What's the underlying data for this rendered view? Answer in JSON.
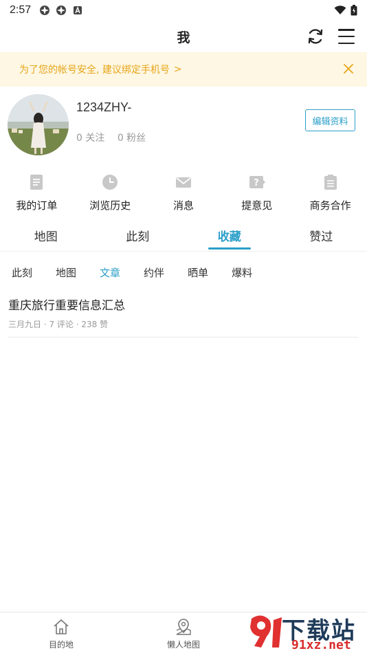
{
  "status_bar": {
    "time": "2:57"
  },
  "header": {
    "title": "我"
  },
  "notice": {
    "text": "为了您的帐号安全, 建议绑定手机号",
    "chevron": ">"
  },
  "profile": {
    "username": "1234ZHY-",
    "following": "0 关注",
    "fans": "0 粉丝",
    "edit_label": "编辑资料"
  },
  "quick_actions": [
    {
      "label": "我的订单",
      "icon": "order-icon"
    },
    {
      "label": "浏览历史",
      "icon": "clock-icon"
    },
    {
      "label": "消息",
      "icon": "mail-icon"
    },
    {
      "label": "提意见",
      "icon": "feedback-icon"
    },
    {
      "label": "商务合作",
      "icon": "clipboard-icon"
    }
  ],
  "tabs": [
    {
      "label": "地图"
    },
    {
      "label": "此刻"
    },
    {
      "label": "收藏",
      "active": true
    },
    {
      "label": "赞过"
    }
  ],
  "subtabs": [
    {
      "label": "此刻"
    },
    {
      "label": "地图"
    },
    {
      "label": "文章",
      "active": true
    },
    {
      "label": "约伴"
    },
    {
      "label": "晒单"
    },
    {
      "label": "爆料"
    }
  ],
  "articles": [
    {
      "title": "重庆旅行重要信息汇总",
      "meta": "三月九日 · 7 评论 · 238 赞"
    }
  ],
  "bottom_nav": [
    {
      "label": "目的地",
      "icon": "home-icon"
    },
    {
      "label": "懒人地图",
      "icon": "map-pin-icon"
    }
  ],
  "watermark": {
    "title": "下载站",
    "url": "91xz.net"
  },
  "colors": {
    "accent": "#2b9fc8",
    "notice_text": "#e8a51a",
    "notice_bg": "#fdf7e3"
  }
}
